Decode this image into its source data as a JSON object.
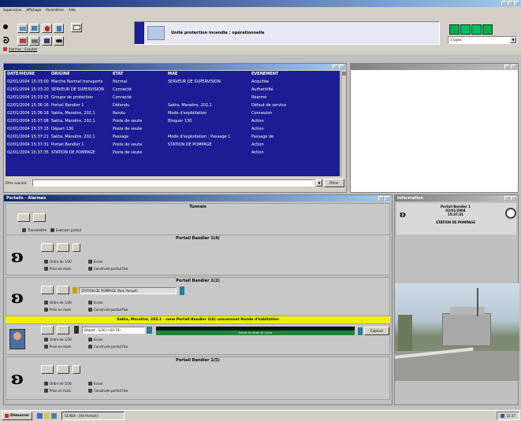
{
  "menubar": {
    "items": [
      "Supervision",
      "Affichage",
      "Paramètres",
      "Aide"
    ]
  },
  "status_banner": {
    "text": "Unité protection incendie : opérationnelle"
  },
  "top_right": {
    "select_value": "1 Ligne"
  },
  "toolbar": {
    "link_label": "Alarmes - Ecoutes"
  },
  "events": {
    "columns": [
      "DATE/HEURE",
      "ORIGINE",
      "ETAT",
      "MAE",
      "EVENEMENT"
    ],
    "rows": [
      [
        "02/01/2004 15:33:00",
        "Marche Normal transports",
        "Normal",
        "SERVEUR DE SUPERVISION",
        "Acquitée"
      ],
      [
        "02/01/2004 15:33:20",
        "SERVEUR DE SUPERVISION",
        "Connecté",
        "",
        "Authentifié"
      ],
      [
        "02/01/2004 15:33:25",
        "Groupe de protection",
        "Connecté",
        "",
        "Réarmé"
      ],
      [
        "02/01/2004 15:36:16",
        "Portail Bandier 1",
        "Défendu",
        "Sakta, Maraitre, 202.1",
        "Défaut de service"
      ],
      [
        "02/01/2004 15:36:18",
        "Sakta, Maraitre, 202.1",
        "Rendu",
        "Mode d'exploitation",
        "Connexion"
      ],
      [
        "02/01/2004 15:37:06",
        "Sakta, Maraitre, 202.1",
        "Poste de veute",
        "Bloquer 130",
        "Action"
      ],
      [
        "02/01/2004 15:37:15",
        "Départ 130",
        "Poste de veute",
        "",
        "Action"
      ],
      [
        "02/01/2004 15:37:21",
        "Sakta, Maraitre, 202.1",
        "Passage",
        "Mode d'exploitation : Passage 1",
        "Passage de"
      ],
      [
        "02/01/2004 15:37:31",
        "Portail Bandier 1",
        "Poste de veute",
        "STATION DE POMPAGE",
        "Action"
      ],
      [
        "02/01/2004 15:37:35",
        "STATION DE POMPAGE",
        "Poste de veute",
        "",
        "Action"
      ]
    ]
  },
  "filter": {
    "label": "Filtre courant",
    "button": "Filtrer"
  },
  "left_panel": {
    "title": "Portails - Alarmes",
    "general": {
      "title": "Tunnels",
      "link": "Transmettre",
      "link2": "Exécuter portail"
    },
    "sections": [
      {
        "title": "Portail Bandier 1(4)",
        "opt1": "Ordre de 1/30",
        "opt2": "Ecran",
        "opt3": "Prise en main",
        "opt4": "Construire portail fixe"
      },
      {
        "title": "Portail Bandier 1(2)",
        "station": "STATION DE POMPAGE (Nok Pompé)",
        "opt1": "Ordre de 1/30",
        "opt2": "Ecran",
        "opt3": "Prise en main",
        "opt4": "Construire portail fixe"
      },
      {
        "title": "Portail Bandier 1(5)",
        "opt1": "Ordre de 1/30",
        "opt2": "Ecran",
        "opt3": "Prise en main",
        "opt4": "Construire portail fixe"
      }
    ],
    "alarm": {
      "banner": "Sakta, Maraitre, 202.1 - zone Portail Bandier 1(6) concernant Ronde d'habitation",
      "dropdown": "Départ : 1/30 (+29.70)",
      "buttons": [
        "Capture"
      ],
      "opt1": "Ordre de 1/30",
      "opt2": "Ecran",
      "opt3": "Prise en main",
      "opt4": "Construire portail fixe",
      "bar_text": "Suivre la ronde en cours"
    }
  },
  "right_panel": {
    "title": "Information",
    "card_title": "Portail Bandier 1",
    "card_date": "02/01/2004",
    "card_time": "15:37:31",
    "card_station": "STATION DE POMPAGE"
  },
  "taskbar": {
    "start": "Démarrer",
    "task": "SCADA - [Alt Portails]",
    "clock": "15:37"
  },
  "colors": {
    "grid_bg": "#1c1c94",
    "banner_yellow": "#f0f000",
    "title_blue": "#0a246a"
  }
}
